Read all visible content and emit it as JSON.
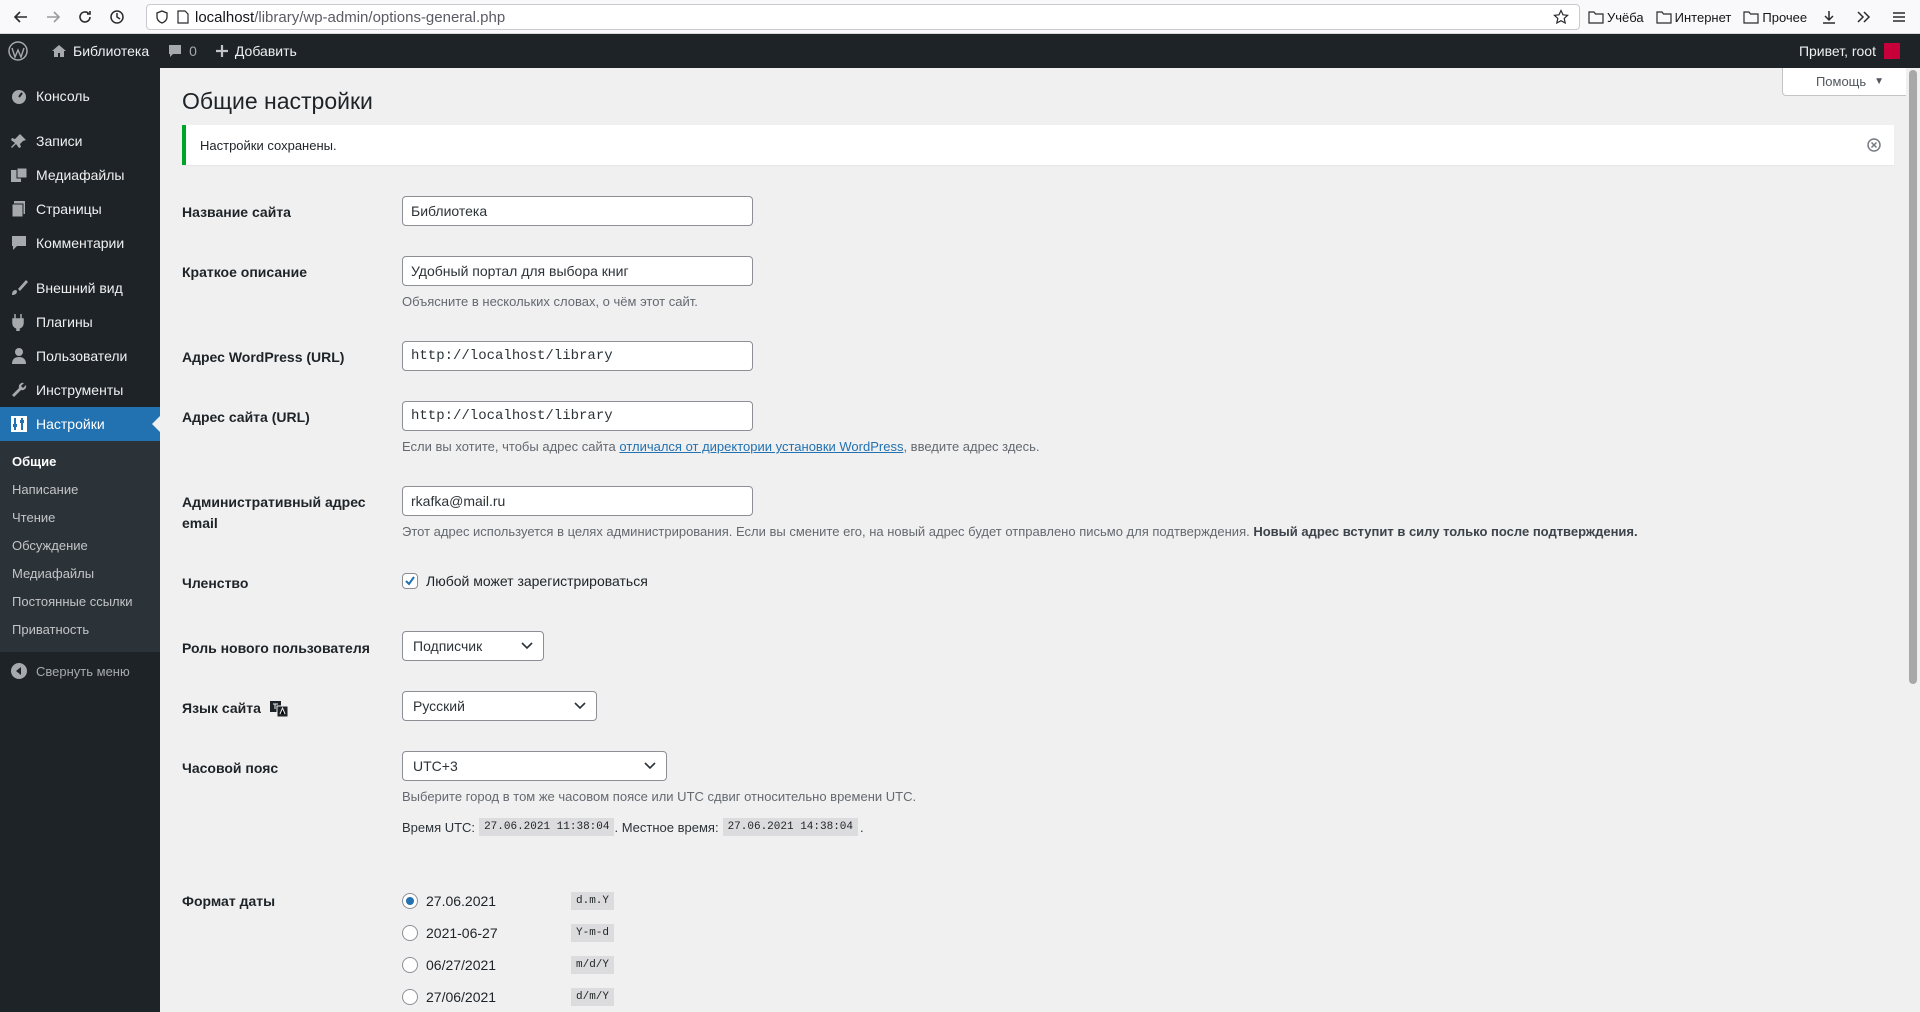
{
  "browser": {
    "url_host": "localhost",
    "url_path": "/library/wp-admin/options-general.php",
    "bookmarks": [
      "Учёба",
      "Интернет",
      "Прочее"
    ]
  },
  "admin_bar": {
    "site_name": "Библиотека",
    "comments_count": "0",
    "add_new": "Добавить",
    "greeting": "Привет, root"
  },
  "sidebar": {
    "items": [
      {
        "label": "Консоль",
        "icon": "dashboard-icon"
      },
      {
        "label": "Записи",
        "icon": "pin-icon"
      },
      {
        "label": "Медиафайлы",
        "icon": "media-icon"
      },
      {
        "label": "Страницы",
        "icon": "pages-icon"
      },
      {
        "label": "Комментарии",
        "icon": "comment-icon"
      },
      {
        "label": "Внешний вид",
        "icon": "brush-icon"
      },
      {
        "label": "Плагины",
        "icon": "plugin-icon"
      },
      {
        "label": "Пользователи",
        "icon": "users-icon"
      },
      {
        "label": "Инструменты",
        "icon": "wrench-icon"
      },
      {
        "label": "Настройки",
        "icon": "settings-icon"
      }
    ],
    "submenu": [
      "Общие",
      "Написание",
      "Чтение",
      "Обсуждение",
      "Медиафайлы",
      "Постоянные ссылки",
      "Приватность"
    ],
    "collapse": "Свернуть меню"
  },
  "page": {
    "title": "Общие настройки",
    "help": "Помощь",
    "notice": "Настройки сохранены."
  },
  "form": {
    "site_title": {
      "label": "Название сайта",
      "value": "Библиотека"
    },
    "tagline": {
      "label": "Краткое описание",
      "value": "Удобный портал для выбора книг",
      "desc": "Объясните в нескольких словах, о чём этот сайт."
    },
    "wp_url": {
      "label": "Адрес WordPress (URL)",
      "value": "http://localhost/library"
    },
    "site_url": {
      "label": "Адрес сайта (URL)",
      "value": "http://localhost/library",
      "desc_before": "Если вы хотите, чтобы адрес сайта ",
      "desc_link": "отличался от директории установки WordPress",
      "desc_after": ", введите адрес здесь."
    },
    "admin_email": {
      "label": "Административный адрес email",
      "value": "rkafka@mail.ru",
      "desc": "Этот адрес используется в целях администрирования. Если вы смените его, на новый адрес будет отправлено письмо для подтверждения. ",
      "desc_strong": "Новый адрес вступит в силу только после подтверждения."
    },
    "membership": {
      "label": "Членство",
      "checkbox": "Любой может зарегистрироваться",
      "checked": true
    },
    "default_role": {
      "label": "Роль нового пользователя",
      "value": "Подписчик"
    },
    "language": {
      "label": "Язык сайта",
      "value": "Русский"
    },
    "timezone": {
      "label": "Часовой пояс",
      "value": "UTC+3",
      "desc": "Выберите город в том же часовом поясе или UTC сдвиг относительно времени UTC.",
      "utc_label": "Время UTC:",
      "utc_value": "27.06.2021 11:38:04",
      "local_label": ". Местное время:",
      "local_value": "27.06.2021 14:38:04",
      "end": "."
    },
    "date_format": {
      "label": "Формат даты",
      "options": [
        {
          "label": "27.06.2021",
          "code": "d.m.Y",
          "checked": true
        },
        {
          "label": "2021-06-27",
          "code": "Y-m-d",
          "checked": false
        },
        {
          "label": "06/27/2021",
          "code": "m/d/Y",
          "checked": false
        },
        {
          "label": "27/06/2021",
          "code": "d/m/Y",
          "checked": false
        }
      ]
    }
  }
}
